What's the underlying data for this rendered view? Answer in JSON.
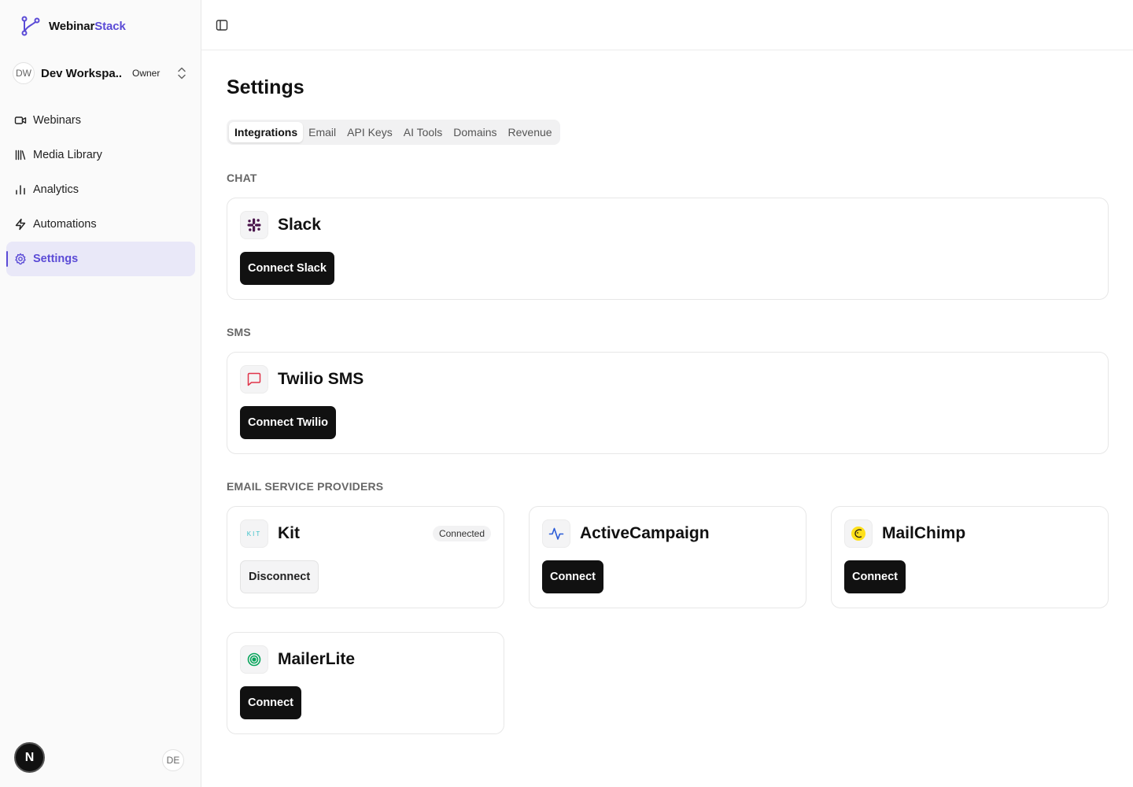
{
  "brand": {
    "name_main": "Webinar",
    "name_accent": "Stack",
    "accent_color": "#5b4bd6"
  },
  "workspace": {
    "initials": "DW",
    "name": "Dev Workspa...",
    "role": "Owner"
  },
  "nav": {
    "items": [
      {
        "label": "Webinars",
        "icon": "video-icon"
      },
      {
        "label": "Media Library",
        "icon": "library-icon"
      },
      {
        "label": "Analytics",
        "icon": "bar-chart-icon"
      },
      {
        "label": "Automations",
        "icon": "zap-icon"
      },
      {
        "label": "Settings",
        "icon": "gear-icon",
        "active": true
      }
    ]
  },
  "footer": {
    "n_badge": "N",
    "user_initials": "DE"
  },
  "page": {
    "title": "Settings"
  },
  "tabs": [
    {
      "label": "Integrations",
      "active": true
    },
    {
      "label": "Email"
    },
    {
      "label": "API Keys"
    },
    {
      "label": "AI Tools"
    },
    {
      "label": "Domains"
    },
    {
      "label": "Revenue"
    }
  ],
  "sections": {
    "chat": {
      "label": "CHAT",
      "slack": {
        "title": "Slack",
        "button": "Connect Slack",
        "icon": "slack-icon"
      }
    },
    "sms": {
      "label": "SMS",
      "twilio": {
        "title": "Twilio SMS",
        "button": "Connect Twilio",
        "icon": "message-square-icon"
      }
    },
    "esp": {
      "label": "EMAIL SERVICE PROVIDERS",
      "kit": {
        "title": "Kit",
        "logo_text": "KIT",
        "status": "Connected",
        "button": "Disconnect",
        "icon": "kit-logo-icon"
      },
      "activecampaign": {
        "title": "ActiveCampaign",
        "button": "Connect",
        "icon": "activity-icon"
      },
      "mailchimp": {
        "title": "MailChimp",
        "button": "Connect",
        "icon": "mailchimp-icon"
      },
      "mailerlite": {
        "title": "MailerLite",
        "button": "Connect",
        "icon": "mailerlite-icon"
      }
    }
  }
}
